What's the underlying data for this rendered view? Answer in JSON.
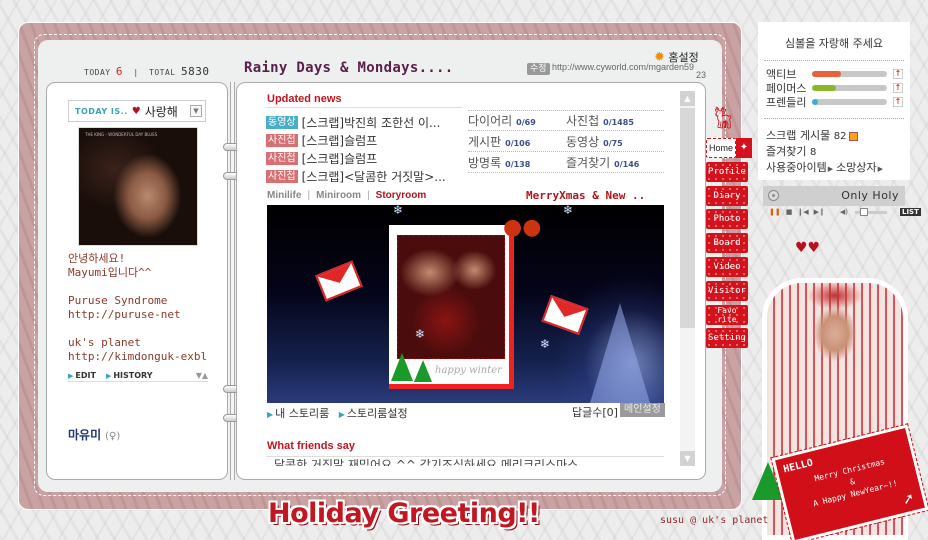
{
  "counter": {
    "today_label": "TODAY",
    "today": "6",
    "total_label": "TOTAL",
    "total": "5830"
  },
  "header": {
    "title": "Rainy Days & Mondays....",
    "home_settings": "홈설정",
    "edit_label": "수정",
    "url": "http://www.cyworld.com/mgarden59",
    "url_suffix": "23"
  },
  "profile": {
    "today_is_label": "TODAY IS..",
    "mood": "사랑해",
    "photo_caption": "THE KING - WONDERFUL DAY BLUES",
    "bio": "안녕하세요!\nMayumi입니다^^\n\nPuruse Syndrome\nhttp://puruse-net\n\nuk's planet\nhttp://kimdonguk-exbl",
    "edit": "EDIT",
    "history": "HISTORY",
    "name": "마유미",
    "gender": "(♀)"
  },
  "updated_news": {
    "title": "Updated news",
    "items": [
      {
        "tag": "동영상",
        "type": "video",
        "text": "[스크랩]박진희 조한선 이..."
      },
      {
        "tag": "사진첩",
        "type": "photo",
        "text": "[스크랩]슬럼프"
      },
      {
        "tag": "사진첩",
        "type": "photo",
        "text": "[스크랩]슬럼프"
      },
      {
        "tag": "사진첩",
        "type": "photo",
        "text": "[스크랩]<달콤한 거짓말>..."
      }
    ]
  },
  "stats": [
    [
      {
        "label": "다이어리",
        "count": "0/69"
      },
      {
        "label": "사진첩",
        "count": "0/1485"
      }
    ],
    [
      {
        "label": "게시판",
        "count": "0/106"
      },
      {
        "label": "동영상",
        "count": "0/75"
      }
    ],
    [
      {
        "label": "방명록",
        "count": "0/138"
      },
      {
        "label": "즐겨찾기",
        "count": "0/146"
      }
    ]
  ],
  "room": {
    "tabs": [
      "Minilife",
      "Miniroom",
      "Storyroom"
    ],
    "active_tab": "Storyroom",
    "caption": "MerryXmas & New ..",
    "photo_text": "happy winter",
    "my_storyroom": "내 스토리룸",
    "storyroom_settings": "스토리룸설정",
    "reply_label": "답글수[0]",
    "main_settings": "메인설정"
  },
  "friends": {
    "title": "What friends say",
    "preview": "달콤한 거짓말 재밌어요 ^^ 감기조심하세요 메리크리스마스"
  },
  "menu": {
    "tabs": [
      "Home",
      "Profile",
      "Diary",
      "Photo",
      "Board",
      "Video",
      "Visitor",
      "Favo\nrite",
      "Setting"
    ],
    "active": "Home"
  },
  "side": {
    "title": "심볼을 자랑해 주세요",
    "meters": [
      {
        "name": "액티브",
        "value": 0.38,
        "color": "#e8613a"
      },
      {
        "name": "페이머스",
        "value": 0.32,
        "color": "#8ab82a"
      },
      {
        "name": "프렌들리",
        "value": 0.08,
        "color": "#3aaed0"
      }
    ],
    "scrap_label": "스크랩 게시물",
    "scrap_count": "82",
    "fav_label": "즐겨찾기",
    "fav_count": "8",
    "items_link": "사용중아이템",
    "wish_link": "소망상자"
  },
  "player": {
    "song": "Only Holy",
    "list_label": "LIST",
    "volume": 0.2
  },
  "decor": {
    "greeting": "Holiday Greeting!!",
    "signature": "susu @ uk's planet",
    "card_hello": "HELLO",
    "card_message": "Merry Christmas\n&\nA Happy NewYear~!!"
  }
}
